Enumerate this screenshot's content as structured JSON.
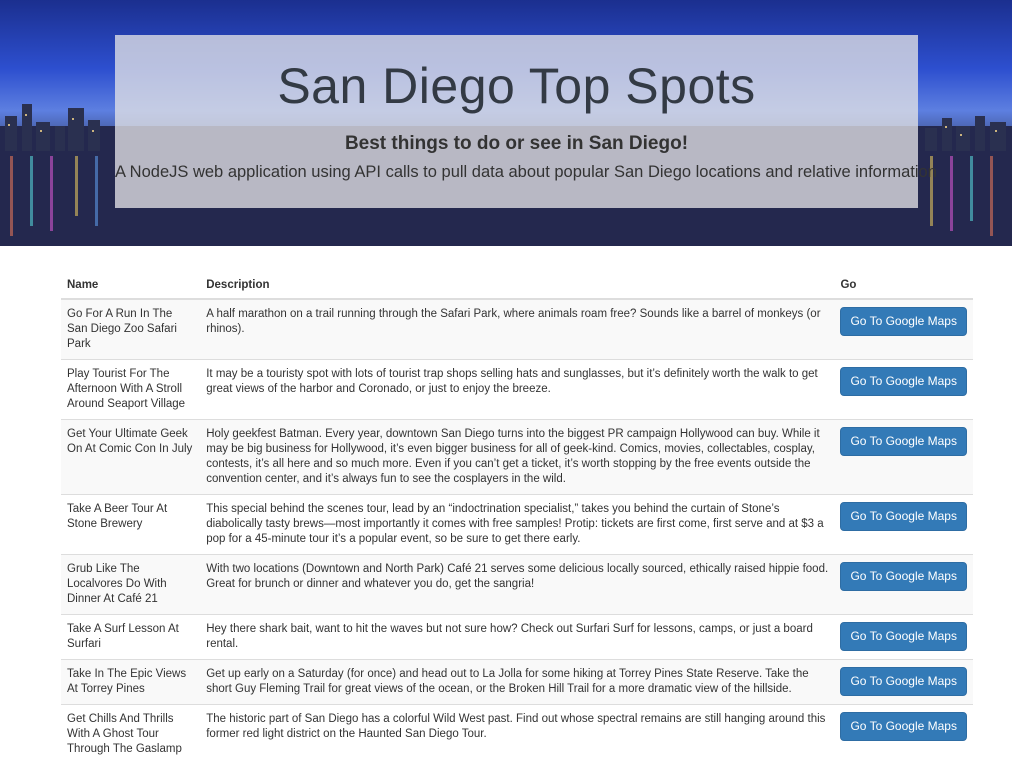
{
  "header": {
    "title": "San Diego Top Spots",
    "subtitle": "Best things to do or see in San Diego!",
    "tagline": "A NodeJS web application using API calls to pull data about popular San Diego locations and relative information"
  },
  "table": {
    "columns": [
      "Name",
      "Description",
      "Go"
    ],
    "button_label": "Go To Google Maps",
    "rows": [
      {
        "name": "Go For A Run In The San Diego Zoo Safari Park",
        "description": "A half marathon on a trail running through the Safari Park, where animals roam free? Sounds like a barrel of monkeys (or rhinos)."
      },
      {
        "name": "Play Tourist For The Afternoon With A Stroll Around Seaport Village",
        "description": "It may be a touristy spot with lots of tourist trap shops selling hats and sunglasses, but it’s definitely worth the walk to get great views of the harbor and Coronado, or just to enjoy the breeze."
      },
      {
        "name": "Get Your Ultimate Geek On At Comic Con In July",
        "description": "Holy geekfest Batman. Every year, downtown San Diego turns into the biggest PR campaign Hollywood can buy. While it may be big business for Hollywood, it’s even bigger business for all of geek-kind. Comics, movies, collectables, cosplay, contests, it’s all here and so much more. Even if you can’t get a ticket, it’s worth stopping by the free events outside the convention center, and it’s always fun to see the cosplayers in the wild."
      },
      {
        "name": "Take A Beer Tour At Stone Brewery",
        "description": "This special behind the scenes tour, lead by an “indoctrination specialist,” takes you behind the curtain of Stone’s diabolically tasty brews—most importantly it comes with free samples! Protip: tickets are first come, first serve and at $3 a pop for a 45-minute tour it’s a popular event, so be sure to get there early."
      },
      {
        "name": "Grub Like The Localvores Do With Dinner At Café 21",
        "description": "With two locations (Downtown and North Park) Café 21 serves some delicious locally sourced, ethically raised hippie food. Great for brunch or dinner and whatever you do, get the sangria!"
      },
      {
        "name": "Take A Surf Lesson At Surfari",
        "description": "Hey there shark bait, want to hit the waves but not sure how? Check out Surfari Surf for lessons, camps, or just a board rental."
      },
      {
        "name": "Take In The Epic Views At Torrey Pines",
        "description": "Get up early on a Saturday (for once) and head out to La Jolla for some hiking at Torrey Pines State Reserve. Take the short Guy Fleming Trail for great views of the ocean, or the Broken Hill Trail for a more dramatic view of the hillside."
      },
      {
        "name": "Get Chills And Thrills With A Ghost Tour Through The Gaslamp",
        "description": "The historic part of San Diego has a colorful Wild West past. Find out whose spectral remains are still hanging around this former red light district on the Haunted San Diego Tour."
      }
    ]
  }
}
